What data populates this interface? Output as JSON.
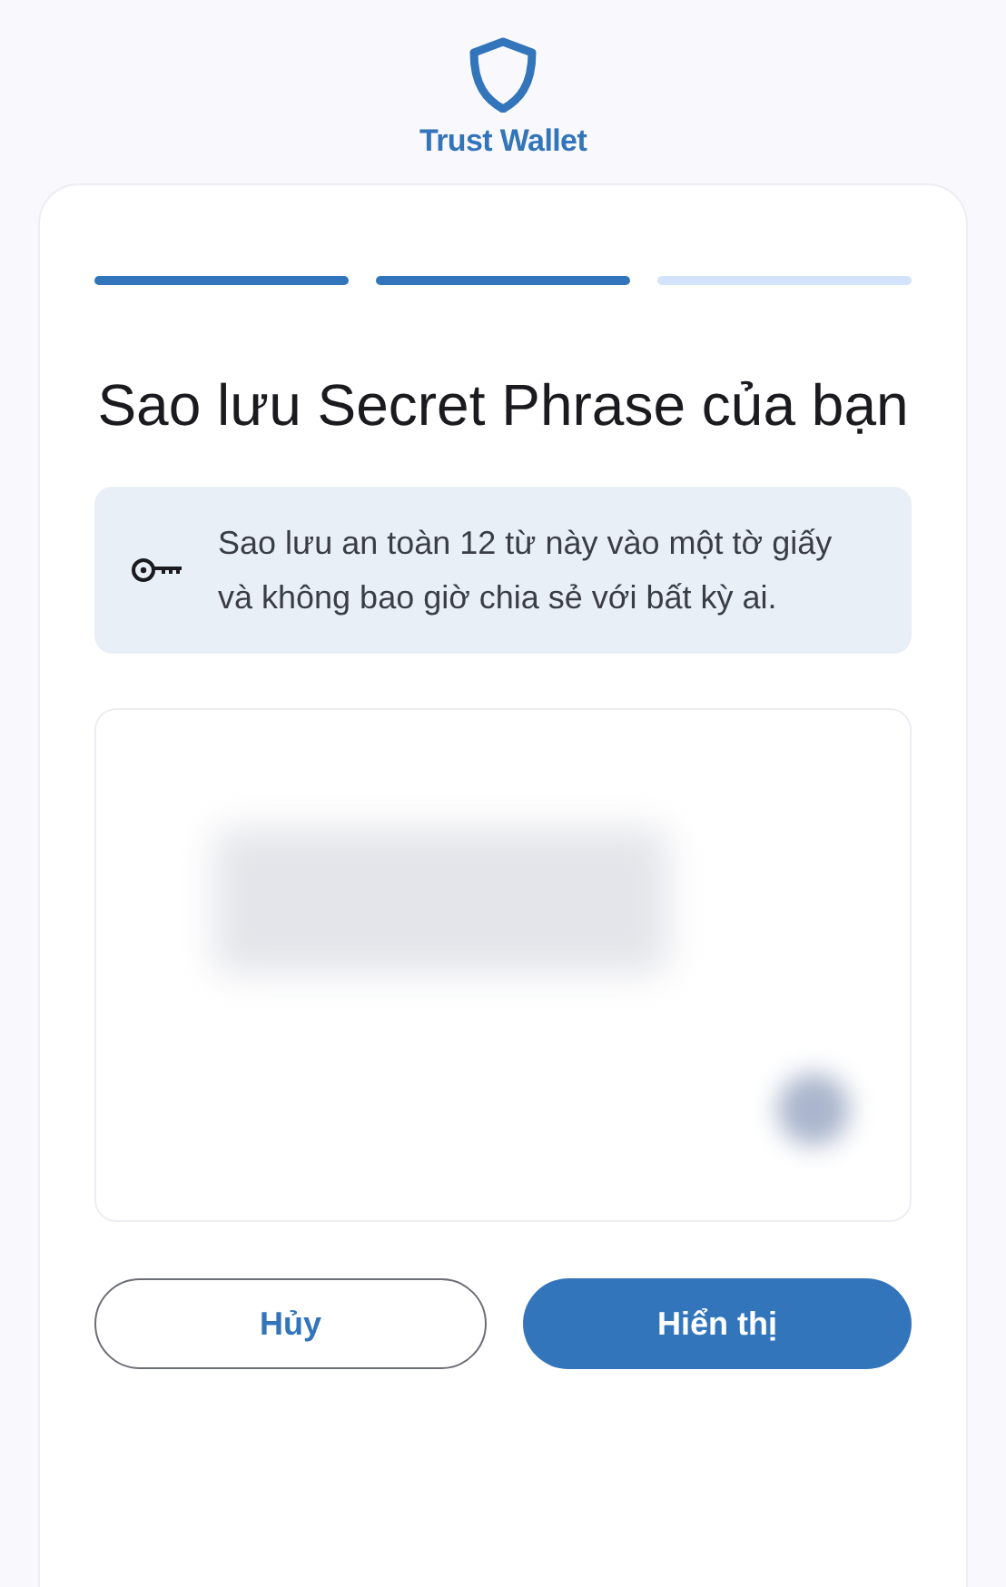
{
  "brand": {
    "name": "Trust Wallet"
  },
  "steps": [
    {
      "done": true
    },
    {
      "done": true
    },
    {
      "done": false
    }
  ],
  "title": "Sao lưu Secret Phrase của bạn",
  "notice": "Sao lưu an toàn 12 từ này vào một tờ giấy và không bao giờ chia sẻ với bất kỳ ai.",
  "phrase_panel": {
    "hidden": true
  },
  "buttons": [
    {
      "label": "Hủy",
      "kind": "secondary"
    },
    {
      "label": "Hiển thị",
      "kind": "primary"
    }
  ]
}
